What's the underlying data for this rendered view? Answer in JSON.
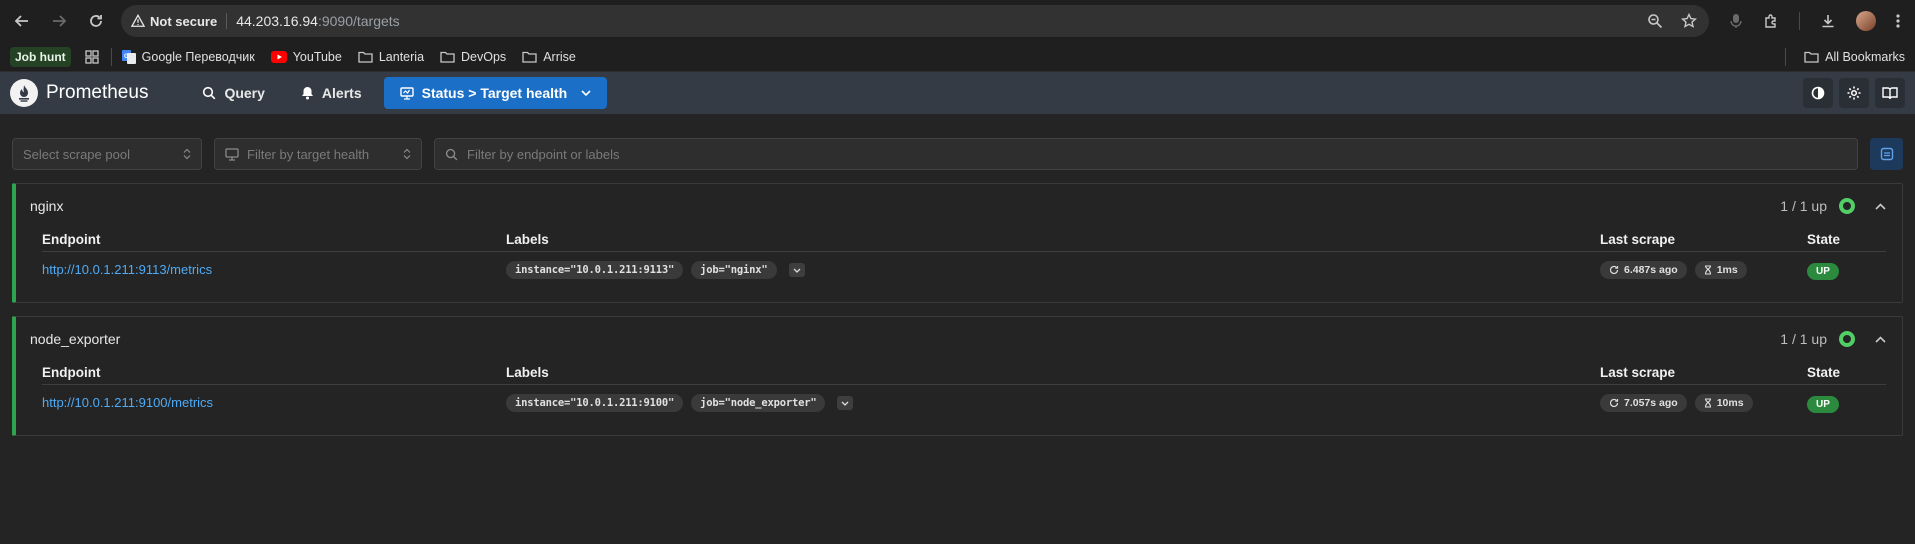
{
  "browser": {
    "security_label": "Not secure",
    "url_host": "44.203.16.94",
    "url_rest": ":9090/targets"
  },
  "bookmarks": {
    "chip": "Job hunt",
    "items": [
      {
        "label": "Google Переводчик",
        "icon": "google-translate-icon"
      },
      {
        "label": "YouTube",
        "icon": "youtube-icon"
      },
      {
        "label": "Lanteria",
        "icon": "folder-icon"
      },
      {
        "label": "DevOps",
        "icon": "folder-icon"
      },
      {
        "label": "Arrise",
        "icon": "folder-icon"
      }
    ],
    "all_label": "All Bookmarks"
  },
  "app": {
    "brand": "Prometheus",
    "nav": {
      "query": "Query",
      "alerts": "Alerts",
      "status": "Status > Target health"
    }
  },
  "filters": {
    "scrape_pool_placeholder": "Select scrape pool",
    "health_placeholder": "Filter by target health",
    "search_placeholder": "Filter by endpoint or labels"
  },
  "columns": {
    "endpoint": "Endpoint",
    "labels": "Labels",
    "last_scrape": "Last scrape",
    "state": "State"
  },
  "pools": [
    {
      "name": "nginx",
      "count": "1 / 1 up",
      "target": {
        "endpoint": "http://10.0.1.211:9113/metrics",
        "labels": [
          "instance=\"10.0.1.211:9113\"",
          "job=\"nginx\""
        ],
        "last_scrape": "6.487s ago",
        "duration": "1ms",
        "state": "UP"
      }
    },
    {
      "name": "node_exporter",
      "count": "1 / 1 up",
      "target": {
        "endpoint": "http://10.0.1.211:9100/metrics",
        "labels": [
          "instance=\"10.0.1.211:9100\"",
          "job=\"node_exporter\""
        ],
        "last_scrape": "7.057s ago",
        "duration": "10ms",
        "state": "UP"
      }
    }
  ],
  "colors": {
    "accent": "#1c6fc6",
    "healthy": "#2fa44f",
    "up_badge": "#2b8a3e",
    "link": "#4dabf7"
  }
}
